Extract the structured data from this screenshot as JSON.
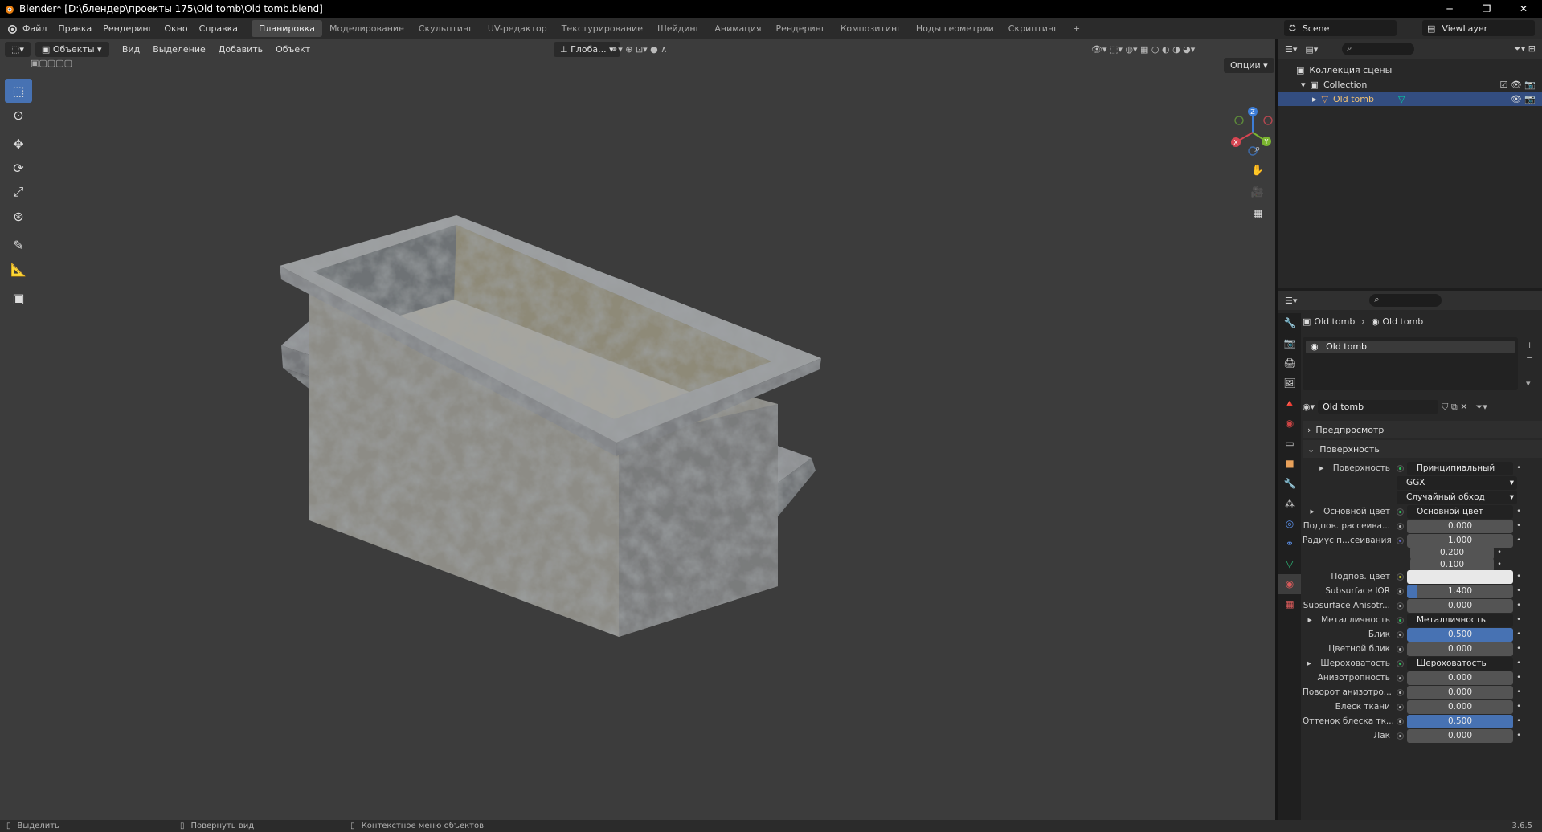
{
  "title": "Blender* [D:\\блендер\\проекты 175\\Old tomb\\Old tomb.blend]",
  "menu": [
    "Файл",
    "Правка",
    "Рендеринг",
    "Окно",
    "Справка"
  ],
  "workspaces": [
    "Планировка",
    "Моделирование",
    "Скульптинг",
    "UV-редактор",
    "Текстурирование",
    "Шейдинг",
    "Анимация",
    "Рендеринг",
    "Композитинг",
    "Ноды геометрии",
    "Скриптинг",
    "+"
  ],
  "active_workspace": "Планировка",
  "scene": "Scene",
  "view_layer": "ViewLayer",
  "viewport": {
    "mode": "Объекты",
    "menus": [
      "Вид",
      "Выделение",
      "Добавить",
      "Объект"
    ],
    "orientation": "Глоба...",
    "options": "Опции"
  },
  "gizmo": {
    "z": "Z",
    "x": "X",
    "y": "Y"
  },
  "outliner": {
    "scene_collection": "Коллекция сцены",
    "collection": "Collection",
    "object": "Old tomb"
  },
  "properties": {
    "breadcrumb_object": "Old tomb",
    "breadcrumb_material": "Old tomb",
    "slot": "Old tomb",
    "material_name": "Old tomb",
    "preview": "Предпросмотр",
    "surface_panel": "Поверхность",
    "rows": [
      {
        "label": "Поверхность",
        "value": "Принципиальный BSDF",
        "kind": "link"
      },
      {
        "label": "",
        "value": "GGX",
        "kind": "select"
      },
      {
        "label": "",
        "value": "Случайный обход",
        "kind": "select"
      },
      {
        "label": "Основной цвет",
        "value": "Основной цвет",
        "kind": "link"
      },
      {
        "label": "Подпов. рассеива...",
        "value": "0.000",
        "kind": "num"
      },
      {
        "label": "Радиус п...сеивания",
        "value": "1.000",
        "kind": "num"
      },
      {
        "label": "",
        "value": "0.200",
        "kind": "num"
      },
      {
        "label": "",
        "value": "0.100",
        "kind": "num"
      },
      {
        "label": "Подпов. цвет",
        "value": "",
        "kind": "color"
      },
      {
        "label": "Subsurface IOR",
        "value": "1.400",
        "kind": "num"
      },
      {
        "label": "Subsurface Anisotr...",
        "value": "0.000",
        "kind": "num"
      },
      {
        "label": "Металличность",
        "value": "Металличность",
        "kind": "link"
      },
      {
        "label": "Блик",
        "value": "0.500",
        "kind": "num"
      },
      {
        "label": "Цветной блик",
        "value": "0.000",
        "kind": "num"
      },
      {
        "label": "Шероховатость",
        "value": "Шероховатость",
        "kind": "link"
      },
      {
        "label": "Анизотропность",
        "value": "0.000",
        "kind": "num"
      },
      {
        "label": "Поворот анизотро...",
        "value": "0.000",
        "kind": "num"
      },
      {
        "label": "Блеск ткани",
        "value": "0.000",
        "kind": "num"
      },
      {
        "label": "Оттенок блеска тк...",
        "value": "0.500",
        "kind": "num"
      },
      {
        "label": "Лак",
        "value": "0.000",
        "kind": "num"
      }
    ],
    "fill": {
      "Subsurface IOR": 0.1,
      "Блик": 1.0,
      "Оттенок блеска тк...": 1.0
    }
  },
  "status": {
    "select": "Выделить",
    "rotate": "Повернуть вид",
    "context": "Контекстное меню объектов",
    "version": "3.6.5"
  },
  "colors": {
    "accent": "#4772b3",
    "selected_row": "#334d80",
    "viewport_bg": "#3c3c3c"
  }
}
